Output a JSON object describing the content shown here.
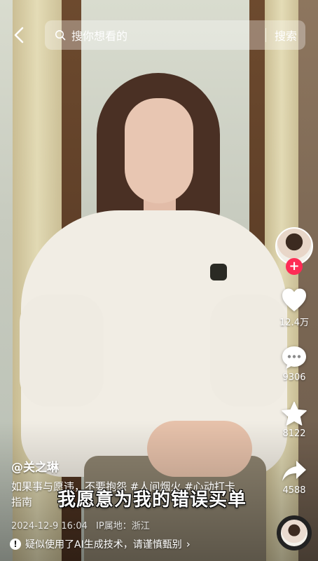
{
  "search": {
    "placeholder": "搜你想看的",
    "button_label": "搜索"
  },
  "actions": {
    "like_count": "12.4万",
    "comment_count": "9306",
    "favorite_count": "8122",
    "share_count": "4588"
  },
  "post": {
    "author": "@关之琳",
    "description_text": "如果事与愿违，不要抱怨 ",
    "tags": [
      "#人间烟火",
      "#心动打卡指南"
    ],
    "subtitle": "我愿意为我的错误买单",
    "date": "2024-12-9 16:04",
    "ip_location": "IP属地：浙江"
  },
  "notice": {
    "text": "疑似使用了AI生成技术，请谨慎甄别"
  },
  "colors": {
    "follow_accent": "#fe2c55"
  },
  "icons": [
    "back-icon",
    "search-icon",
    "heart-icon",
    "comment-icon",
    "star-icon",
    "share-icon",
    "warning-icon",
    "chevron-right-icon"
  ]
}
